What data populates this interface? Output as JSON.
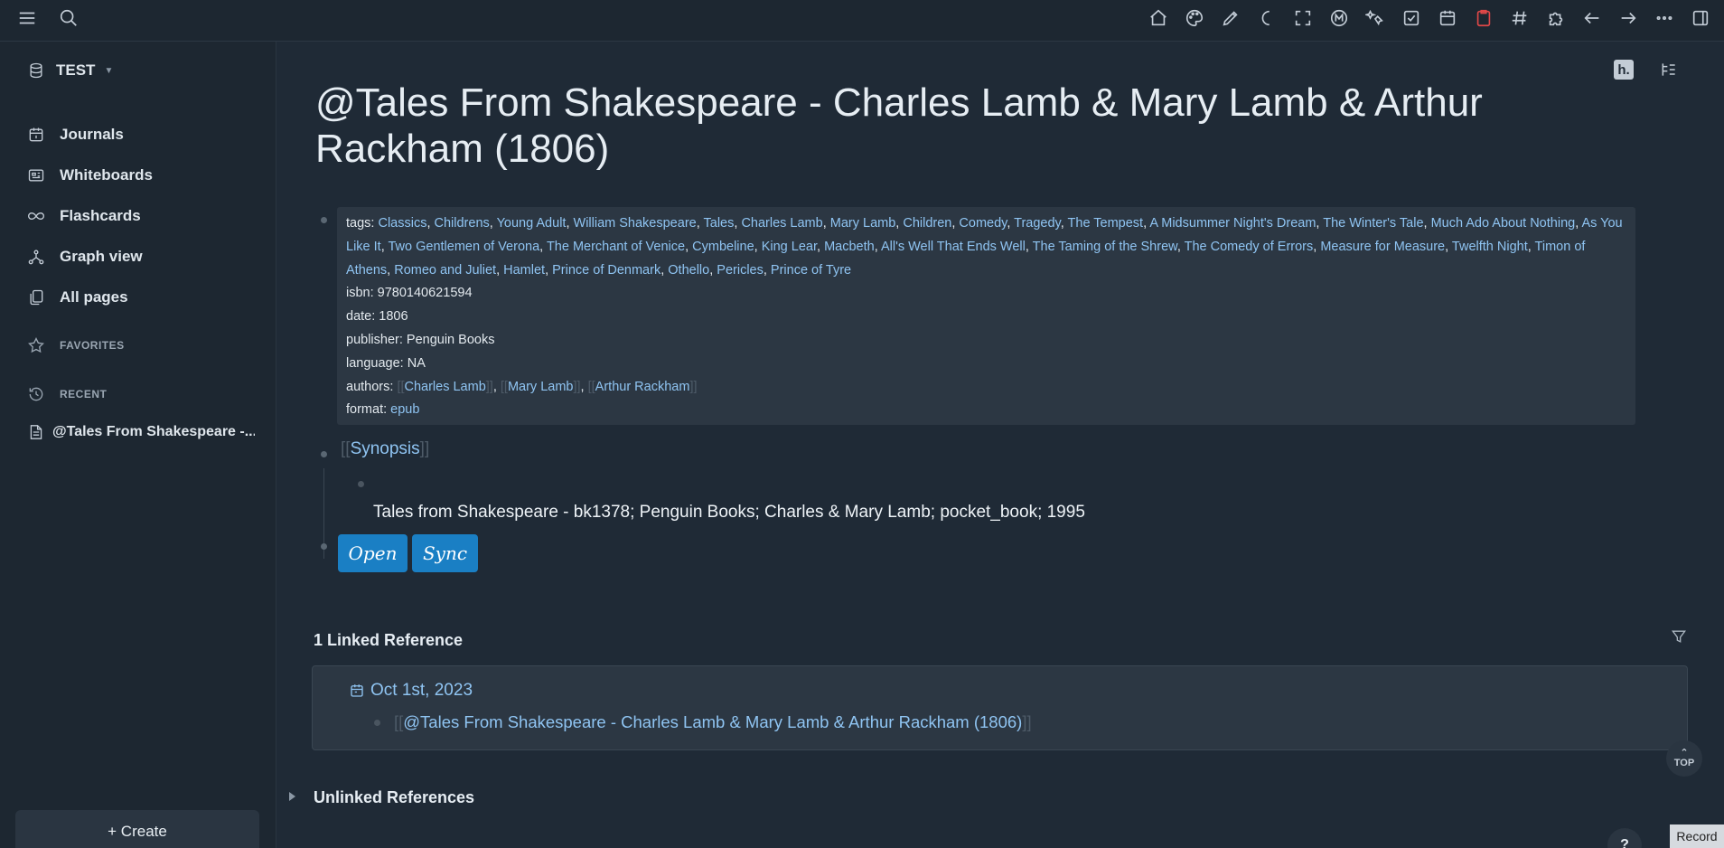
{
  "topbar": {
    "left_icons": [
      "menu-icon",
      "search-icon"
    ],
    "right_icons": [
      "home-icon",
      "palette-icon",
      "pen-icon",
      "moon-icon",
      "fullscreen-icon",
      "m-logo-icon",
      "stars-icon",
      "checkbox-icon",
      "calendar-icon",
      "clipboard-icon",
      "hash-icon",
      "puzzle-icon",
      "arrow-left-icon",
      "arrow-right-icon",
      "more-icon",
      "sidebar-toggle-icon"
    ]
  },
  "sidebar": {
    "graph_name": "TEST",
    "nav": [
      {
        "label": "Journals",
        "icon": "calendar-icon"
      },
      {
        "label": "Whiteboards",
        "icon": "whiteboard-icon"
      },
      {
        "label": "Flashcards",
        "icon": "infinity-icon"
      },
      {
        "label": "Graph view",
        "icon": "graph-icon"
      },
      {
        "label": "All pages",
        "icon": "pages-icon"
      }
    ],
    "favorites_label": "FAVORITES",
    "recent_label": "RECENT",
    "recent_item": "@Tales From Shakespeare -...",
    "create_label": "+ Create"
  },
  "page": {
    "title": "@Tales From Shakespeare - Charles Lamb & Mary Lamb & Arthur Rackham (1806)",
    "props": {
      "tags_key": "tags:",
      "tags": [
        "Classics",
        "Childrens",
        "Young Adult",
        "William Shakespeare",
        "Tales",
        "Charles Lamb",
        "Mary Lamb",
        "Children",
        "Comedy",
        "Tragedy",
        "The Tempest",
        "A Midsummer Night's Dream",
        "The Winter's Tale",
        "Much Ado About Nothing",
        "As You Like It",
        "Two Gentlemen of Verona",
        "The Merchant of Venice",
        "Cymbeline",
        "King Lear",
        "Macbeth",
        "All's Well That Ends Well",
        "The Taming of the Shrew",
        "The Comedy of Errors",
        "Measure for Measure",
        "Twelfth Night",
        "Timon of Athens",
        "Romeo and Juliet",
        "Hamlet",
        "Prince of Denmark",
        "Othello",
        "Pericles",
        "Prince of Tyre"
      ],
      "isbn_key": "isbn:",
      "isbn": "9780140621594",
      "date_key": "date:",
      "date": "1806",
      "publisher_key": "publisher:",
      "publisher": "Penguin Books",
      "language_key": "language:",
      "language": "NA",
      "authors_key": "authors:",
      "authors": [
        "Charles Lamb",
        "Mary Lamb",
        "Arthur Rackham"
      ],
      "format_key": "format:",
      "format": "epub"
    },
    "synopsis": "Synopsis",
    "synopsis_text": "Tales from Shakespeare - bk1378; Penguin Books; Charles & Mary Lamb; pocket_book; 1995",
    "open_label": "Open",
    "sync_label": "Sync",
    "linked_heading": "1 Linked Reference",
    "linked_date": "Oct 1st, 2023",
    "linked_block": "@Tales From Shakespeare - Charles Lamb & Mary Lamb & Arthur Rackham (1806)",
    "unlinked_heading": "Unlinked References",
    "top_label": "TOP",
    "help_label": "?",
    "record_label": "Record"
  },
  "colors": {
    "background": "#1f2a36",
    "sidebar": "#1d2731",
    "link": "#8fc4f2",
    "button": "#1a7fc4"
  }
}
